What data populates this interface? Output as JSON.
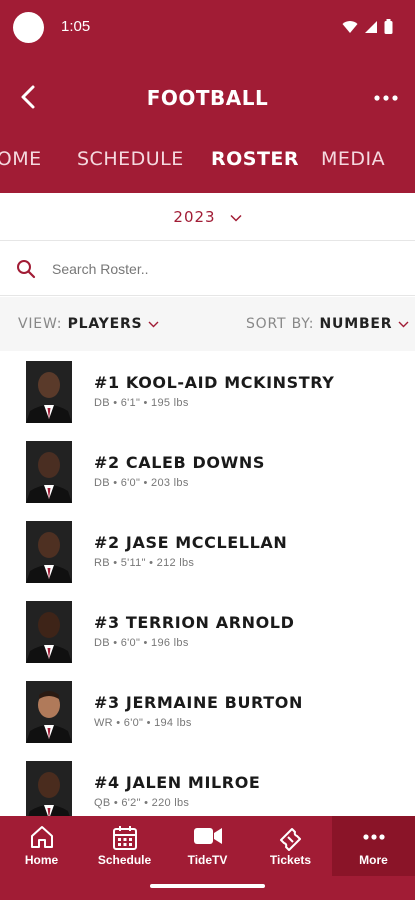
{
  "status_bar": {
    "time": "1:05"
  },
  "header": {
    "title": "FOOTBALL"
  },
  "tabs": [
    {
      "label": "HOME",
      "active": false
    },
    {
      "label": "SCHEDULE",
      "active": false
    },
    {
      "label": "ROSTER",
      "active": true
    },
    {
      "label": "MEDIA",
      "active": false
    }
  ],
  "season": {
    "selected": "2023"
  },
  "search": {
    "placeholder": "Search Roster..",
    "value": ""
  },
  "filters": {
    "view_label": "VIEW:",
    "view_value": "PLAYERS",
    "sort_label": "SORT BY:",
    "sort_value": "NUMBER"
  },
  "players": [
    {
      "name": "#1 KOOL-AID MCKINSTRY",
      "info": "DB • 6'1\" • 195 lbs"
    },
    {
      "name": "#2 CALEB DOWNS",
      "info": "DB • 6'0\" • 203 lbs"
    },
    {
      "name": "#2 JASE MCCLELLAN",
      "info": "RB • 5'11\" • 212 lbs"
    },
    {
      "name": "#3 TERRION ARNOLD",
      "info": "DB • 6'0\" • 196 lbs"
    },
    {
      "name": "#3 JERMAINE BURTON",
      "info": "WR • 6'0\" • 194 lbs"
    },
    {
      "name": "#4 JALEN MILROE",
      "info": "QB • 6'2\" • 220 lbs"
    }
  ],
  "bottom_nav": [
    {
      "label": "Home",
      "icon": "home-icon"
    },
    {
      "label": "Schedule",
      "icon": "calendar-icon"
    },
    {
      "label": "TideTV",
      "icon": "video-camera-icon"
    },
    {
      "label": "Tickets",
      "icon": "ticket-icon"
    },
    {
      "label": "More",
      "icon": "more-dots-icon"
    }
  ],
  "colors": {
    "brand": "#a11c35",
    "brand_dark": "#8a1428"
  }
}
